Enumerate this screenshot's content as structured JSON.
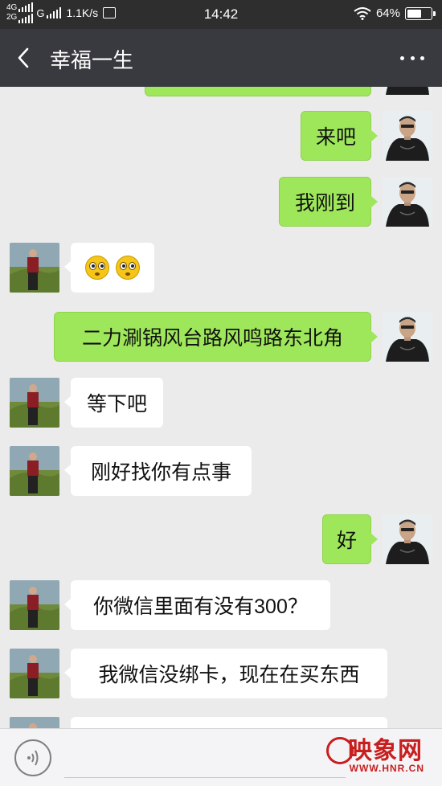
{
  "status_bar": {
    "network_top": "4G",
    "network_bottom": "2G",
    "network_g": "G",
    "speed": "1.1K/s",
    "time": "14:42",
    "battery_percent": "64%",
    "battery_level": 0.64
  },
  "header": {
    "title": "幸福一生",
    "back_icon": "chevron-left-icon",
    "more_icon": "more-dots-icon"
  },
  "messages": [
    {
      "from": "self",
      "text": "来吧"
    },
    {
      "from": "self",
      "text": "我刚到"
    },
    {
      "from": "other",
      "text": "",
      "emoji": [
        "dizzy-emoji",
        "dizzy-emoji"
      ]
    },
    {
      "from": "self",
      "text": "二力涮锅风台路风鸣路东北角"
    },
    {
      "from": "other",
      "text": "等下吧"
    },
    {
      "from": "other",
      "text": "刚好找你有点事"
    },
    {
      "from": "self",
      "text": "好"
    },
    {
      "from": "other",
      "text": "你微信里面有没有300？"
    },
    {
      "from": "other",
      "text": "我微信没绑卡，现在在买东西"
    }
  ],
  "watermark": {
    "name": "映象网",
    "url": "WWW.HNR.CN"
  },
  "colors": {
    "status_bar": "#2e2e2e",
    "title_bar": "#393a3f",
    "chat_bg": "#ebebeb",
    "bubble_out": "#9fe75a",
    "bubble_in": "#ffffff",
    "watermark": "#c81e1e"
  }
}
